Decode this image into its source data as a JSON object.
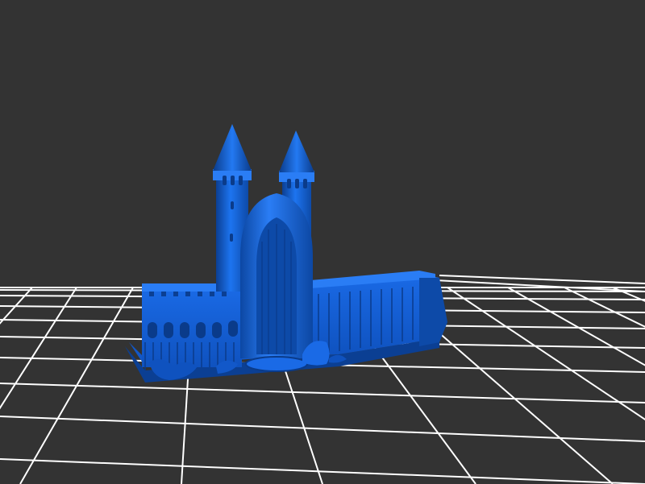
{
  "viewer": {
    "background_color": "#333333",
    "grid_color": "#ffffff",
    "model_color": "#1565d8",
    "model_shadow_color": "#0b3f93",
    "model_highlight_color": "#3f8cff",
    "grid_visible": true,
    "model_subject": "castle-model"
  }
}
